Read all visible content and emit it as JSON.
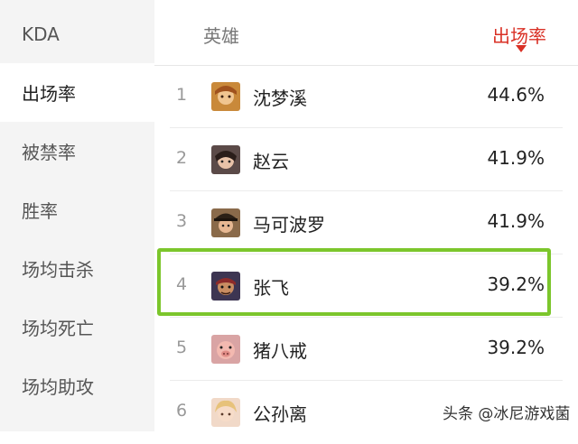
{
  "sidebar": {
    "items": [
      {
        "label": "KDA",
        "active": false
      },
      {
        "label": "出场率",
        "active": true
      },
      {
        "label": "被禁率",
        "active": false
      },
      {
        "label": "胜率",
        "active": false
      },
      {
        "label": "场均击杀",
        "active": false
      },
      {
        "label": "场均死亡",
        "active": false
      },
      {
        "label": "场均助攻",
        "active": false
      }
    ]
  },
  "table": {
    "headers": {
      "hero": "英雄",
      "rate": "出场率"
    },
    "sort_indicator": "caret-down-icon",
    "accent_color": "#d93025",
    "rows": [
      {
        "rank": "1",
        "name": "沈梦溪",
        "rate": "44.6%",
        "avatar": "shen-mengxi-avatar"
      },
      {
        "rank": "2",
        "name": "赵云",
        "rate": "41.9%",
        "avatar": "zhao-yun-avatar"
      },
      {
        "rank": "3",
        "name": "马可波罗",
        "rate": "41.9%",
        "avatar": "marco-polo-avatar"
      },
      {
        "rank": "4",
        "name": "张飞",
        "rate": "39.2%",
        "avatar": "zhang-fei-avatar",
        "highlighted": true
      },
      {
        "rank": "5",
        "name": "猪八戒",
        "rate": "39.2%",
        "avatar": "zhu-bajie-avatar"
      },
      {
        "rank": "6",
        "name": "公孙离",
        "rate": "",
        "avatar": "gongsun-li-avatar"
      }
    ]
  },
  "highlight_color": "#7cc62c",
  "watermark": "头条 @冰尼游戏菌"
}
